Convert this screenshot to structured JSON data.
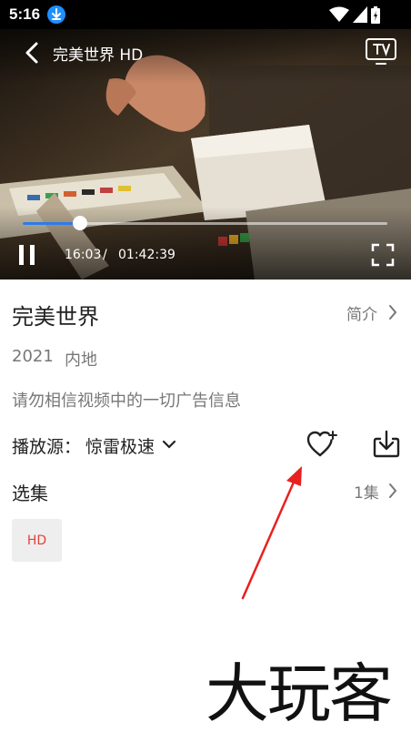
{
  "status_bar": {
    "time": "5:16",
    "icons": [
      "download-badge-icon",
      "wifi-icon",
      "signal-icon",
      "battery-charging-icon"
    ]
  },
  "player": {
    "title": "完美世界 HD",
    "current_time": "16:03",
    "separator": "/",
    "total_time": "01:42:39",
    "progress": 0.158,
    "accent_color": "#2f7be8"
  },
  "info": {
    "title": "完美世界",
    "intro_label": "简介",
    "year": "2021",
    "region": "内地",
    "notice": "请勿相信视频中的一切广告信息",
    "source_label": "播放源：",
    "source_value": "惊雷极速"
  },
  "episodes": {
    "label": "选集",
    "count": "1集",
    "items": [
      "HD"
    ]
  },
  "watermark": "大玩客"
}
